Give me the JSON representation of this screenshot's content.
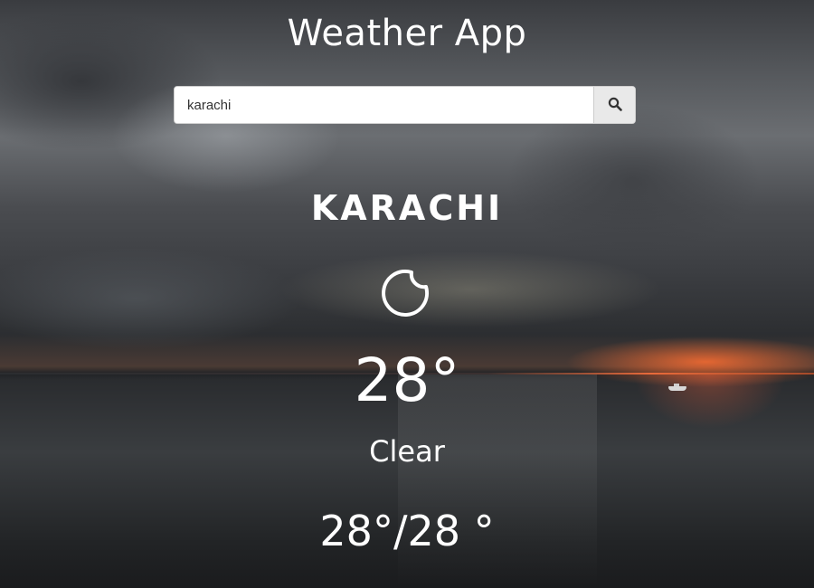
{
  "app": {
    "title": "Weather App"
  },
  "search": {
    "value": "karachi",
    "icon": "search-icon"
  },
  "weather": {
    "city": "KARACHI",
    "icon": "moon-icon",
    "temperature": "28°",
    "condition": "Clear",
    "range": "28°/28 °"
  },
  "colors": {
    "text": "#ffffff",
    "input_bg": "#ffffff",
    "button_bg": "#e9e9e9"
  }
}
